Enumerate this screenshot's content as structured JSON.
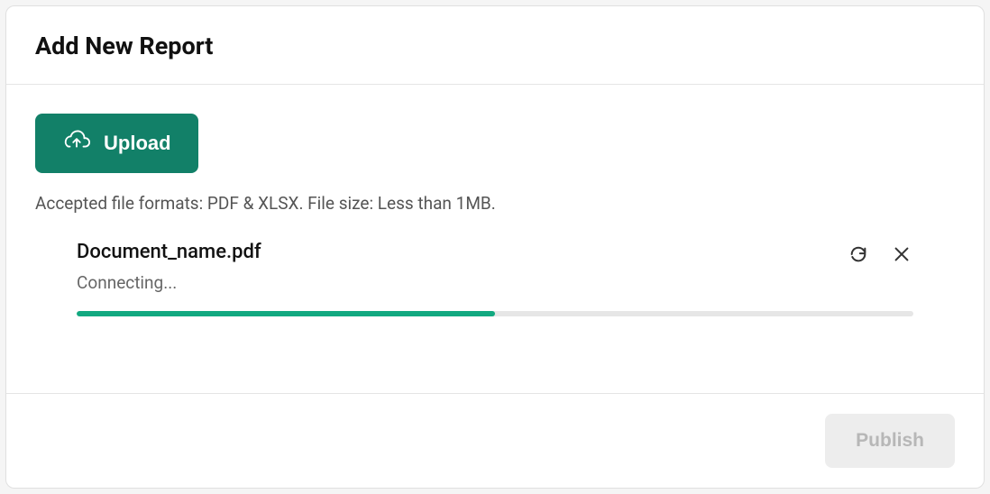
{
  "modal": {
    "title": "Add New Report",
    "upload_label": "Upload",
    "hint": "Accepted file formats: PDF & XLSX. File size: Less than 1MB."
  },
  "file": {
    "name": "Document_name.pdf",
    "status": "Connecting...",
    "progress_percent": 50
  },
  "footer": {
    "publish_label": "Publish"
  },
  "colors": {
    "accent": "#128068",
    "progress": "#12a980"
  }
}
